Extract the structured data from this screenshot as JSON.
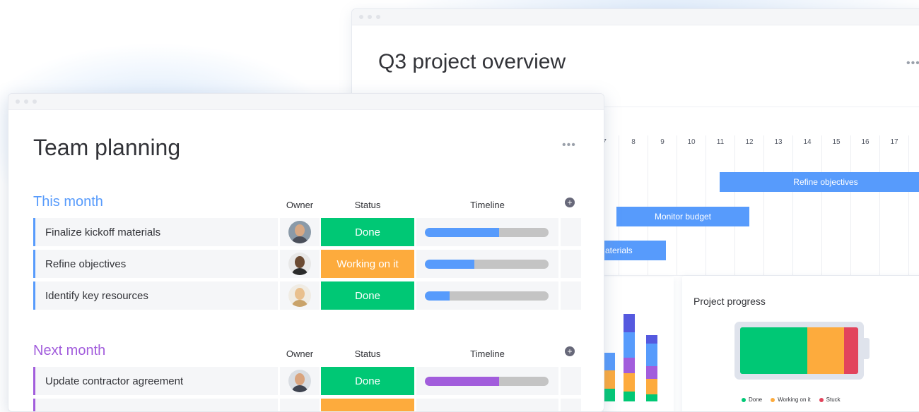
{
  "colors": {
    "accent_blue": "#579bfc",
    "accent_purple": "#a25ddc",
    "done_green": "#00c875",
    "working_orange": "#fdab3d",
    "stuck_red": "#e2445c",
    "text_dark": "#323338"
  },
  "back_window": {
    "title": "Q3 project overview",
    "more_icon": "•••",
    "gantt": {
      "day_numbers": [
        "7",
        "8",
        "9",
        "10",
        "11",
        "12",
        "13",
        "14",
        "15",
        "16",
        "17"
      ],
      "bars": [
        {
          "label": "Refine objectives"
        },
        {
          "label": "Monitor budget"
        },
        {
          "label": "aterials"
        }
      ]
    },
    "stacked_bars": {
      "colors": [
        "#00c875",
        "#fdab3d",
        "#a25ddc",
        "#579bfc",
        "#5559df"
      ]
    },
    "project_progress": {
      "title": "Project progress",
      "segments": [
        {
          "label": "Done",
          "color": "#00c875",
          "fraction": 0.57
        },
        {
          "label": "Working on it",
          "color": "#fdab3d",
          "fraction": 0.31
        },
        {
          "label": "Stuck",
          "color": "#e2445c",
          "fraction": 0.12
        }
      ]
    }
  },
  "front_window": {
    "title": "Team planning",
    "more_icon": "•••",
    "groups": [
      {
        "title": "This month",
        "color": "#579bfc",
        "columns": {
          "owner": "Owner",
          "status": "Status",
          "timeline": "Timeline",
          "add": "+"
        },
        "rows": [
          {
            "name": "Finalize kickoff materials",
            "status": "Done",
            "status_color": "#00c875",
            "timeline_progress": 0.6
          },
          {
            "name": "Refine objectives",
            "status": "Working on it",
            "status_color": "#fdab3d",
            "timeline_progress": 0.4
          },
          {
            "name": "Identify key resources",
            "status": "Done",
            "status_color": "#00c875",
            "timeline_progress": 0.2
          }
        ]
      },
      {
        "title": "Next month",
        "color": "#a25ddc",
        "columns": {
          "owner": "Owner",
          "status": "Status",
          "timeline": "Timeline",
          "add": "+"
        },
        "rows": [
          {
            "name": "Update contractor agreement",
            "status": "Done",
            "status_color": "#00c875",
            "timeline_progress": 0.6
          }
        ]
      }
    ]
  }
}
